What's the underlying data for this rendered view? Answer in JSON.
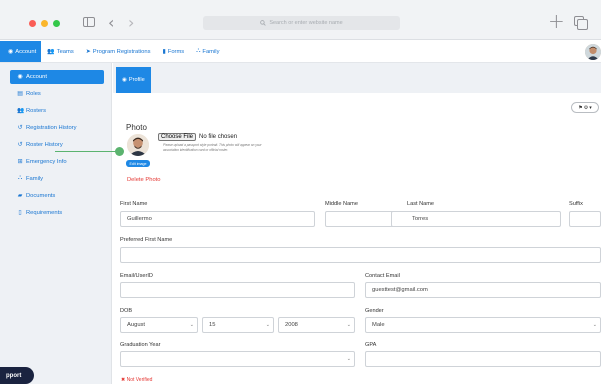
{
  "browser": {
    "url_placeholder": "Search or enter website name"
  },
  "topnav": {
    "items": [
      {
        "label": "Account",
        "icon": "user-circle-icon"
      },
      {
        "label": "Teams",
        "icon": "users-icon"
      },
      {
        "label": "Program Registrations",
        "icon": "paper-plane-icon"
      },
      {
        "label": "Forms",
        "icon": "file-icon"
      },
      {
        "label": "Family",
        "icon": "sitemap-icon"
      }
    ]
  },
  "sidebar": {
    "items": [
      {
        "label": "Account",
        "icon": "user-circle-icon"
      },
      {
        "label": "Roles",
        "icon": "id-card-icon"
      },
      {
        "label": "Rosters",
        "icon": "users-icon"
      },
      {
        "label": "Registration History",
        "icon": "history-icon"
      },
      {
        "label": "Roster History",
        "icon": "history-icon"
      },
      {
        "label": "Emergency Info",
        "icon": "plus-square-icon"
      },
      {
        "label": "Family",
        "icon": "sitemap-icon"
      },
      {
        "label": "Documents",
        "icon": "folder-icon"
      },
      {
        "label": "Requirements",
        "icon": "file-alt-icon"
      }
    ],
    "support_label": "pport"
  },
  "main": {
    "tab_label": "Profile",
    "photo": {
      "title": "Photo",
      "choose_label": "Choose File",
      "file_status": "No file chosen",
      "hint": "Please upload a passport style portrait. This photo will appear on your association identification card or official roster.",
      "edit_label": "Edit image",
      "delete_label": "Delete Photo"
    },
    "form": {
      "first_name_label": "First Name",
      "first_name_value": "Guillermo",
      "middle_name_label": "Middle Name",
      "middle_name_value": "",
      "last_name_label": "Last Name",
      "last_name_value": "Torres",
      "suffix_label": "Suffix",
      "preferred_label": "Preferred First Name",
      "email_label": "Email/UserID",
      "contact_email_label": "Contact Email",
      "contact_email_value": "guesttest@gmail.com",
      "dob_label": "DOB",
      "dob_month": "August",
      "dob_day": "15",
      "dob_year": "2008",
      "gender_label": "Gender",
      "gender_value": "Male",
      "grad_year_label": "Graduation Year",
      "gpa_label": "GPA",
      "not_verified": "✖ Not Verified"
    }
  },
  "colors": {
    "primary": "#1e88e5",
    "link": "#1976d2",
    "danger": "#e53935",
    "accent_line": "#5bb36f",
    "support": "#1a2340"
  }
}
